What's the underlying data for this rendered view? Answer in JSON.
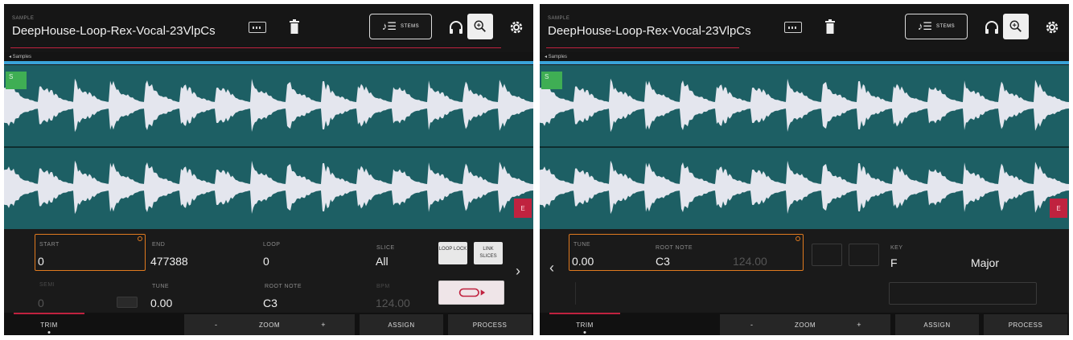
{
  "left": {
    "header": {
      "section_label": "SAMPLE",
      "sample_name": "DeepHouse-Loop-Rex-Vocal-23VlpCs",
      "stems_label": "STEMS"
    },
    "ruler": {
      "label": "◂ Samples"
    },
    "waveform": {
      "start_marker": "S",
      "end_marker": "E"
    },
    "params": {
      "start_label": "START",
      "start_value": "0",
      "end_label": "END",
      "end_value": "477388",
      "loop_label": "LOOP",
      "loop_value": "0",
      "slice_label": "SLICE",
      "slice_value": "All",
      "loop_lock_label": "LOOP LOCK",
      "link_slices_label": "LINK SLICES",
      "tune_label": "TUNE",
      "tune_value": "0.00",
      "root_note_label": "ROOT NOTE",
      "root_note_value": "C3",
      "bpm_label": "BPM",
      "bpm_value": "124.00",
      "faint_label": "SEMI",
      "faint_value": "0"
    },
    "tabs": {
      "trim": "TRIM",
      "zoom": "ZOOM",
      "zoom_minus": "-",
      "zoom_plus": "+",
      "assign": "ASSIGN",
      "process": "PROCESS"
    }
  },
  "right": {
    "header": {
      "section_label": "SAMPLE",
      "sample_name": "DeepHouse-Loop-Rex-Vocal-23VlpCs",
      "stems_label": "STEMS"
    },
    "ruler": {
      "label": "◂ Samples"
    },
    "waveform": {
      "start_marker": "S",
      "end_marker": "E"
    },
    "params": {
      "tune_label": "TUNE",
      "tune_value": "0.00",
      "root_note_label": "ROOT NOTE",
      "root_note_value": "C3",
      "bpm_value": "124.00",
      "key_label": "KEY",
      "key_value": "F",
      "scale_value": "Major"
    },
    "tabs": {
      "trim": "TRIM",
      "zoom": "ZOOM",
      "zoom_minus": "-",
      "zoom_plus": "+",
      "assign": "ASSIGN",
      "process": "PROCESS"
    }
  },
  "colors": {
    "waveform_bg": "#1d5f64",
    "accent_red": "#c0223f",
    "accent_blue": "#3aa3d9",
    "focus_orange": "#e07a1f",
    "start_green": "#3fae54"
  },
  "icons": [
    "keyboard-icon",
    "trash-icon",
    "stems-icon",
    "headphones-icon",
    "zoom-icon",
    "gear-icon",
    "loop-icon",
    "chevron-left-icon",
    "chevron-right-icon"
  ]
}
